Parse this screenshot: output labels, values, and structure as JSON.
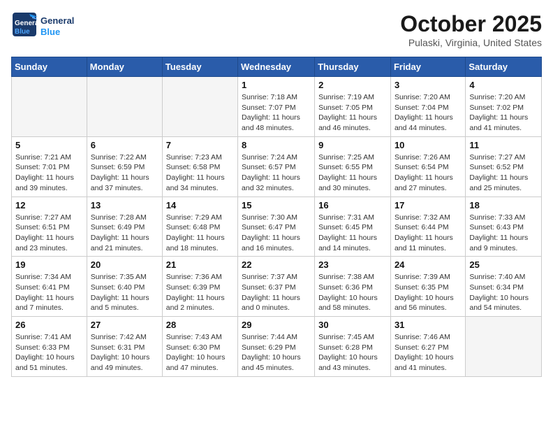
{
  "header": {
    "logo_line1": "General",
    "logo_line2": "Blue",
    "month_title": "October 2025",
    "location": "Pulaski, Virginia, United States"
  },
  "weekdays": [
    "Sunday",
    "Monday",
    "Tuesday",
    "Wednesday",
    "Thursday",
    "Friday",
    "Saturday"
  ],
  "weeks": [
    [
      {
        "day": "",
        "empty": true
      },
      {
        "day": "",
        "empty": true
      },
      {
        "day": "",
        "empty": true
      },
      {
        "day": "1",
        "sunrise": "7:18 AM",
        "sunset": "7:07 PM",
        "daylight": "11 hours and 48 minutes."
      },
      {
        "day": "2",
        "sunrise": "7:19 AM",
        "sunset": "7:05 PM",
        "daylight": "11 hours and 46 minutes."
      },
      {
        "day": "3",
        "sunrise": "7:20 AM",
        "sunset": "7:04 PM",
        "daylight": "11 hours and 44 minutes."
      },
      {
        "day": "4",
        "sunrise": "7:20 AM",
        "sunset": "7:02 PM",
        "daylight": "11 hours and 41 minutes."
      }
    ],
    [
      {
        "day": "5",
        "sunrise": "7:21 AM",
        "sunset": "7:01 PM",
        "daylight": "11 hours and 39 minutes."
      },
      {
        "day": "6",
        "sunrise": "7:22 AM",
        "sunset": "6:59 PM",
        "daylight": "11 hours and 37 minutes."
      },
      {
        "day": "7",
        "sunrise": "7:23 AM",
        "sunset": "6:58 PM",
        "daylight": "11 hours and 34 minutes."
      },
      {
        "day": "8",
        "sunrise": "7:24 AM",
        "sunset": "6:57 PM",
        "daylight": "11 hours and 32 minutes."
      },
      {
        "day": "9",
        "sunrise": "7:25 AM",
        "sunset": "6:55 PM",
        "daylight": "11 hours and 30 minutes."
      },
      {
        "day": "10",
        "sunrise": "7:26 AM",
        "sunset": "6:54 PM",
        "daylight": "11 hours and 27 minutes."
      },
      {
        "day": "11",
        "sunrise": "7:27 AM",
        "sunset": "6:52 PM",
        "daylight": "11 hours and 25 minutes."
      }
    ],
    [
      {
        "day": "12",
        "sunrise": "7:27 AM",
        "sunset": "6:51 PM",
        "daylight": "11 hours and 23 minutes."
      },
      {
        "day": "13",
        "sunrise": "7:28 AM",
        "sunset": "6:49 PM",
        "daylight": "11 hours and 21 minutes."
      },
      {
        "day": "14",
        "sunrise": "7:29 AM",
        "sunset": "6:48 PM",
        "daylight": "11 hours and 18 minutes."
      },
      {
        "day": "15",
        "sunrise": "7:30 AM",
        "sunset": "6:47 PM",
        "daylight": "11 hours and 16 minutes."
      },
      {
        "day": "16",
        "sunrise": "7:31 AM",
        "sunset": "6:45 PM",
        "daylight": "11 hours and 14 minutes."
      },
      {
        "day": "17",
        "sunrise": "7:32 AM",
        "sunset": "6:44 PM",
        "daylight": "11 hours and 11 minutes."
      },
      {
        "day": "18",
        "sunrise": "7:33 AM",
        "sunset": "6:43 PM",
        "daylight": "11 hours and 9 minutes."
      }
    ],
    [
      {
        "day": "19",
        "sunrise": "7:34 AM",
        "sunset": "6:41 PM",
        "daylight": "11 hours and 7 minutes."
      },
      {
        "day": "20",
        "sunrise": "7:35 AM",
        "sunset": "6:40 PM",
        "daylight": "11 hours and 5 minutes."
      },
      {
        "day": "21",
        "sunrise": "7:36 AM",
        "sunset": "6:39 PM",
        "daylight": "11 hours and 2 minutes."
      },
      {
        "day": "22",
        "sunrise": "7:37 AM",
        "sunset": "6:37 PM",
        "daylight": "11 hours and 0 minutes."
      },
      {
        "day": "23",
        "sunrise": "7:38 AM",
        "sunset": "6:36 PM",
        "daylight": "10 hours and 58 minutes."
      },
      {
        "day": "24",
        "sunrise": "7:39 AM",
        "sunset": "6:35 PM",
        "daylight": "10 hours and 56 minutes."
      },
      {
        "day": "25",
        "sunrise": "7:40 AM",
        "sunset": "6:34 PM",
        "daylight": "10 hours and 54 minutes."
      }
    ],
    [
      {
        "day": "26",
        "sunrise": "7:41 AM",
        "sunset": "6:33 PM",
        "daylight": "10 hours and 51 minutes."
      },
      {
        "day": "27",
        "sunrise": "7:42 AM",
        "sunset": "6:31 PM",
        "daylight": "10 hours and 49 minutes."
      },
      {
        "day": "28",
        "sunrise": "7:43 AM",
        "sunset": "6:30 PM",
        "daylight": "10 hours and 47 minutes."
      },
      {
        "day": "29",
        "sunrise": "7:44 AM",
        "sunset": "6:29 PM",
        "daylight": "10 hours and 45 minutes."
      },
      {
        "day": "30",
        "sunrise": "7:45 AM",
        "sunset": "6:28 PM",
        "daylight": "10 hours and 43 minutes."
      },
      {
        "day": "31",
        "sunrise": "7:46 AM",
        "sunset": "6:27 PM",
        "daylight": "10 hours and 41 minutes."
      },
      {
        "day": "",
        "empty": true
      }
    ]
  ]
}
